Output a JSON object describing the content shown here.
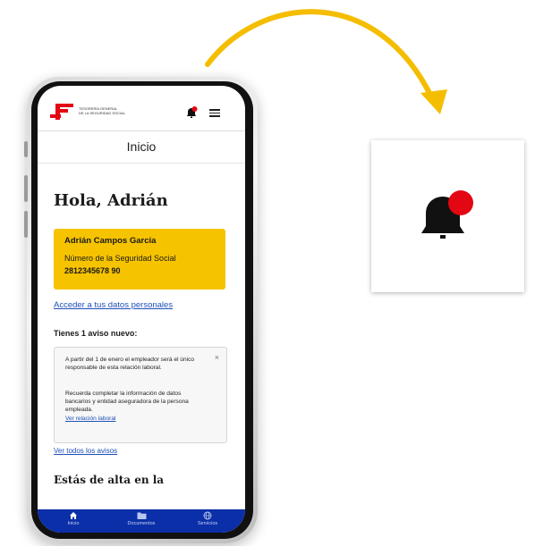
{
  "header": {
    "logo_line1": "TESORERÍA GENERAL",
    "logo_line2": "DE LA SEGURIDAD SOCIAL"
  },
  "page": {
    "title": "Inicio"
  },
  "greeting": "Hola, Adrián",
  "user_card": {
    "name": "Adrián Campos Garcia",
    "ss_label": "Número de la Seguridad Social",
    "ss_number": "2812345678 90"
  },
  "links": {
    "personal_data": "Acceder a tus datos personales",
    "all_notices": "Ver todos los avisos"
  },
  "notices": {
    "heading": "Tienes 1 aviso nuevo:",
    "close": "×",
    "paragraph1": "A partir del 1 de enero el empleador será el único responsable de esta relación laboral.",
    "paragraph2": "Recuerda completar la información de datos bancarios y entidad aseguradora de la persona empleada.",
    "link": "Ver relación laboral"
  },
  "section": {
    "alta_heading": "Estás de alta en la"
  },
  "bottom_nav": {
    "items": [
      {
        "label": "Inicio",
        "icon": "home-icon"
      },
      {
        "label": "Documentos",
        "icon": "folder-icon"
      },
      {
        "label": "Servicios",
        "icon": "globe-icon"
      }
    ]
  },
  "colors": {
    "brand_red": "#e30613",
    "card_yellow": "#f6c300",
    "nav_blue": "#0b2fa8",
    "arrow_yellow": "#f5bd00",
    "link_blue": "#1f4fb8"
  }
}
